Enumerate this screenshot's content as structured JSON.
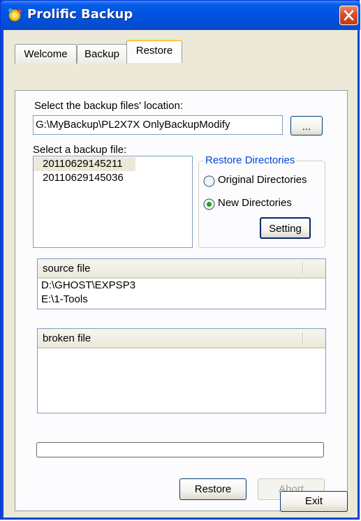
{
  "window": {
    "title": "Prolific Backup"
  },
  "tabs": [
    {
      "label": "Welcome"
    },
    {
      "label": "Backup"
    },
    {
      "label": "Restore"
    }
  ],
  "restore": {
    "location_label": "Select the backup files' location:",
    "location_value": "G:\\MyBackup\\PL2X7X OnlyBackupModify",
    "browse_label": "...",
    "backup_file_label": "Select a backup file:",
    "backup_files": [
      "20110629145211",
      "20110629145036"
    ],
    "selected_backup_index": 0,
    "directories_group": {
      "title": "Restore Directories",
      "options": [
        "Original Directories",
        "New Directories"
      ],
      "selected": "New Directories",
      "setting_label": "Setting"
    },
    "source_files": {
      "header": "source file",
      "rows": [
        "D:\\GHOST\\EXPSP3",
        "E:\\1-Tools"
      ]
    },
    "broken_files": {
      "header": "broken file",
      "rows": []
    },
    "progress": 0,
    "restore_button": "Restore",
    "abort_button": "Abort"
  },
  "exit_button": "Exit",
  "colors": {
    "titlebar": "#0054e3",
    "close_button": "#c13b16",
    "group_title": "#0046d5",
    "tab_highlight": "#ffc83c"
  }
}
